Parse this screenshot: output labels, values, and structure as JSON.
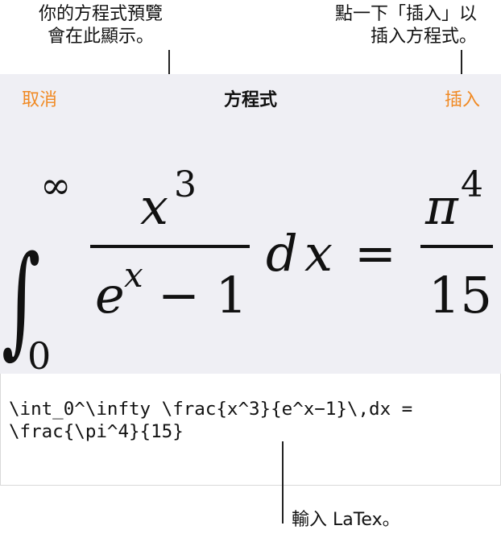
{
  "callouts": {
    "preview_line1": "你的方程式預覽",
    "preview_line2": "會在此顯示。",
    "insert_line1": "點一下「插入」以",
    "insert_line2": "插入方程式。",
    "latex": "輸入 LaTex。"
  },
  "navbar": {
    "cancel_label": "取消",
    "title": "方程式",
    "insert_label": "插入"
  },
  "equation": {
    "integral": "∫",
    "lower_limit": "0",
    "upper_limit": "∞",
    "numerator_base": "x",
    "numerator_exp": "3",
    "denominator_base": "e",
    "denominator_exp": "x",
    "denominator_rest": "− 1",
    "differential_d": "d",
    "differential_x": "x",
    "equals": "=",
    "rhs_numerator_base": "π",
    "rhs_numerator_exp": "4",
    "rhs_denominator": "15"
  },
  "editor": {
    "latex_line1": "\\int_0^\\infty \\frac{x^3}{e^x−1}\\,dx =",
    "latex_line2": "\\frac{\\pi^4}{15}"
  },
  "colors": {
    "accent": "#f08a24",
    "panel_bg": "#efeff4"
  }
}
